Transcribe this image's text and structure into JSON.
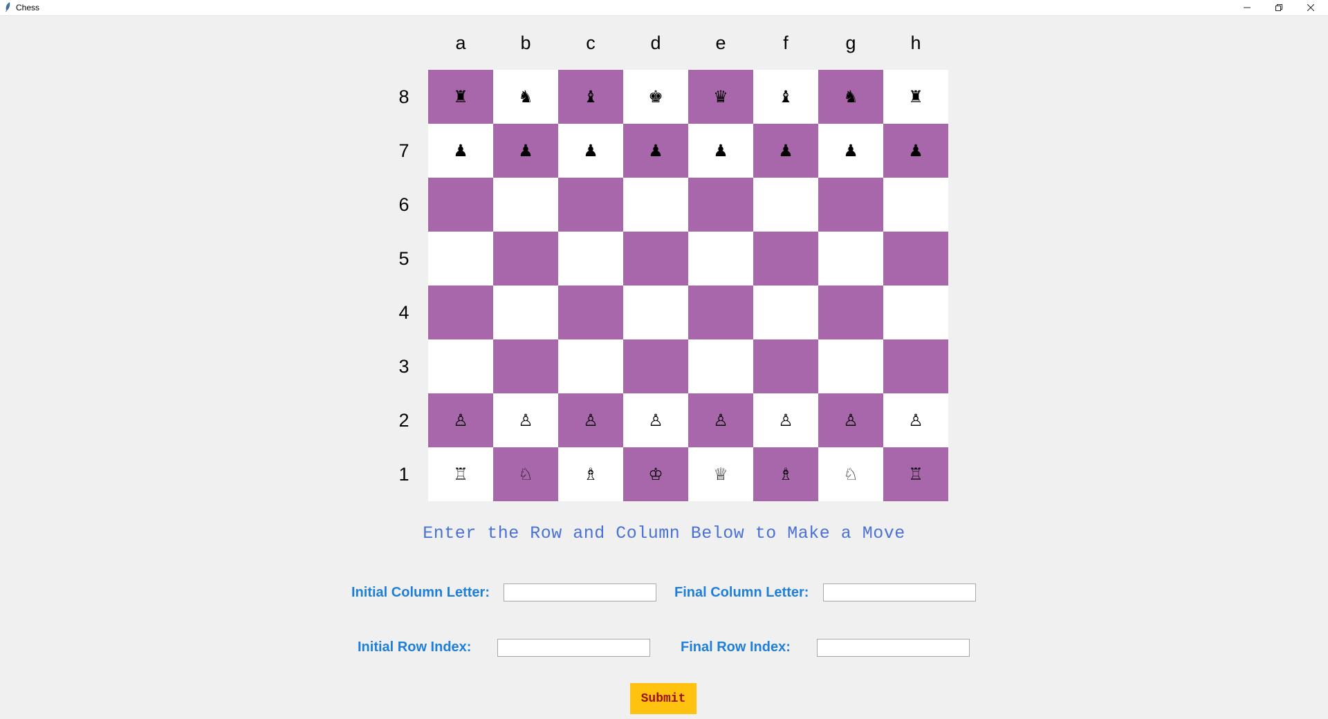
{
  "window": {
    "title": "Chess",
    "controls": {
      "minimize": "–",
      "maximize": "❐",
      "close": "✕"
    }
  },
  "board": {
    "columns": [
      "a",
      "b",
      "c",
      "d",
      "e",
      "f",
      "g",
      "h"
    ],
    "rows": [
      "8",
      "7",
      "6",
      "5",
      "4",
      "3",
      "2",
      "1"
    ],
    "dark_color": "#a866ab",
    "light_color": "#ffffff",
    "squares": [
      [
        "♜",
        "♞",
        "♝",
        "♚",
        "♛",
        "♝",
        "♞",
        "♜"
      ],
      [
        "♟",
        "♟",
        "♟",
        "♟",
        "♟",
        "♟",
        "♟",
        "♟"
      ],
      [
        "",
        "",
        "",
        "",
        "",
        "",
        "",
        ""
      ],
      [
        "",
        "",
        "",
        "",
        "",
        "",
        "",
        ""
      ],
      [
        "",
        "",
        "",
        "",
        "",
        "",
        "",
        ""
      ],
      [
        "",
        "",
        "",
        "",
        "",
        "",
        "",
        ""
      ],
      [
        "♙",
        "♙",
        "♙",
        "♙",
        "♙",
        "♙",
        "♙",
        "♙"
      ],
      [
        "♖",
        "♘",
        "♗",
        "♔",
        "♕",
        "♗",
        "♘",
        "♖"
      ]
    ]
  },
  "instructions": "Enter the Row and Column Below to Make a Move",
  "form": {
    "initial_column_label": "Initial Column Letter:",
    "final_column_label": "Final Column Letter:",
    "initial_row_label": "Initial Row Index:",
    "final_row_label": "Final Row Index:",
    "initial_column_value": "",
    "final_column_value": "",
    "initial_row_value": "",
    "final_row_value": "",
    "submit_label": "Submit"
  },
  "colors": {
    "label_blue": "#1d7fd9",
    "instruction_blue": "#4a72d4",
    "submit_bg": "#ffc20e",
    "submit_text": "#a01010"
  }
}
